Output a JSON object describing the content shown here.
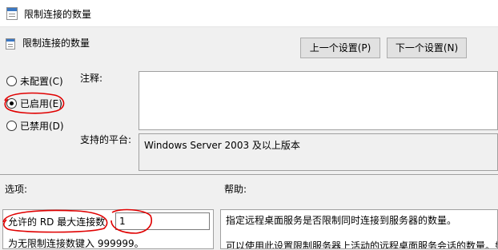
{
  "window": {
    "title": "限制连接的数量"
  },
  "header": {
    "title": "限制连接的数量",
    "prev_button": "上一个设置(P)",
    "next_button": "下一个设置(N)"
  },
  "state": {
    "options": [
      {
        "label": "未配置(C)",
        "checked": false
      },
      {
        "label": "已启用(E)",
        "checked": true
      },
      {
        "label": "已禁用(D)",
        "checked": false
      }
    ]
  },
  "comment": {
    "label": "注释:",
    "value": ""
  },
  "platform": {
    "label": "支持的平台:",
    "value": "Windows Server 2003 及以上版本"
  },
  "options_section": {
    "label": "选项:",
    "field_label": "允许的 RD 最大连接数",
    "field_value": "1",
    "hint": "为无限制连接数键入 999999。"
  },
  "help_section": {
    "label": "帮助:",
    "line1": "指定远程桌面服务是否限制同时连接到服务器的数量。",
    "line2": "可以使用此设置限制服务器上活动的远程桌面服务会话的数量。如"
  },
  "colors": {
    "annotation": "#e00000",
    "accent": "#3b78c4"
  }
}
